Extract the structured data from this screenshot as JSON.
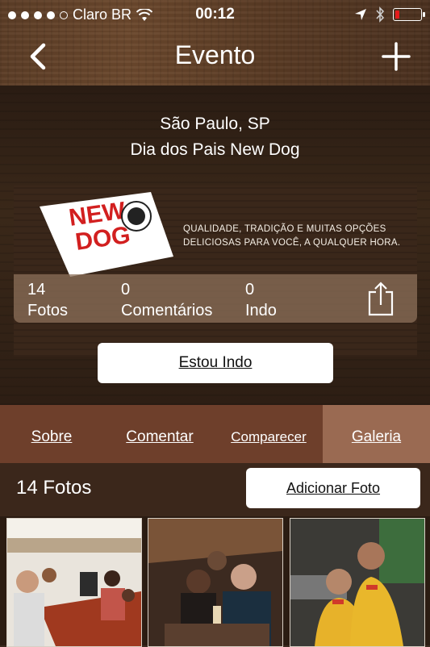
{
  "status_bar": {
    "carrier": "Claro BR",
    "time": "00:12",
    "battery_level": 0.15
  },
  "nav": {
    "title": "Evento"
  },
  "event": {
    "location": "São Paulo, SP",
    "name": "Dia dos Pais New Dog"
  },
  "banner": {
    "logo_line1": "NEW",
    "logo_line2": "DOG",
    "slogan_line1": "QUALIDADE, TRADIÇÃO E MUITAS OPÇÕES",
    "slogan_line2": "DELICIOSAS PARA VOCÊ, A QUALQUER HORA."
  },
  "stats": [
    {
      "value": "14",
      "label": "Fotos"
    },
    {
      "value": "0",
      "label": "Comentários"
    },
    {
      "value": "0",
      "label": "Indo"
    }
  ],
  "going_button": "Estou Indo",
  "tabs": [
    {
      "label": "Sobre",
      "active": false
    },
    {
      "label": "Comentar",
      "active": false
    },
    {
      "label": "Comparecer",
      "active": false
    },
    {
      "label": "Galeria",
      "active": true
    }
  ],
  "gallery": {
    "count_label": "14 Fotos",
    "add_button": "Adicionar Foto"
  },
  "colors": {
    "tab_bar": "#6e3f2b",
    "tab_active": "#9a6a52",
    "battery_red": "#e31b1b"
  }
}
